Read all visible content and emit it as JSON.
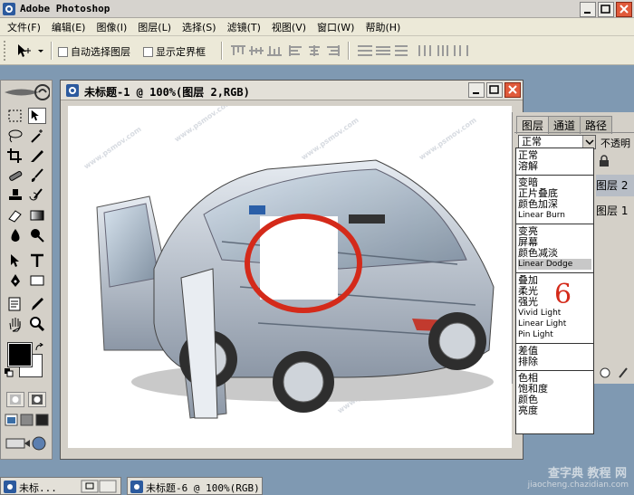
{
  "app": {
    "title": "Adobe Photoshop"
  },
  "menu": [
    "文件(F)",
    "编辑(E)",
    "图像(I)",
    "图层(L)",
    "选择(S)",
    "滤镜(T)",
    "视图(V)",
    "窗口(W)",
    "帮助(H)"
  ],
  "options": {
    "auto_select_label": "自动选择图层",
    "show_bounds_label": "显示定界框"
  },
  "document": {
    "title": "未标题-1 @ 100%(图层 2,RGB)"
  },
  "layers_panel": {
    "tabs": [
      "图层",
      "通道",
      "路径"
    ],
    "blend_mode": "正常",
    "opacity_label": "不透明",
    "layers": [
      "图层 2",
      "图层 1"
    ]
  },
  "blend_modes": [
    [
      "正常",
      "溶解"
    ],
    [
      "变暗",
      "正片叠底",
      "颜色加深",
      "Linear Burn"
    ],
    [
      "变亮",
      "屏幕",
      "颜色减淡",
      "Linear Dodge"
    ],
    [
      "叠加",
      "柔光",
      "强光",
      "Vivid Light",
      "Linear Light",
      "Pin Light"
    ],
    [
      "差值",
      "排除"
    ],
    [
      "色相",
      "饱和度",
      "颜色",
      "亮度"
    ]
  ],
  "highlighted_mode": "Linear Dodge",
  "annotation": "6",
  "taskbar": [
    "未标...",
    "未标题-6 @ 100%(RGB)"
  ],
  "watermark": {
    "main": "查字典 教程 网",
    "sub": "jiaocheng.chazidian.com"
  },
  "canvas_watermark": "www.psmov.com",
  "colors": {
    "circle": "#d42a1a",
    "desktop": "#7f99b2",
    "highlight": "#c8c8c8"
  }
}
